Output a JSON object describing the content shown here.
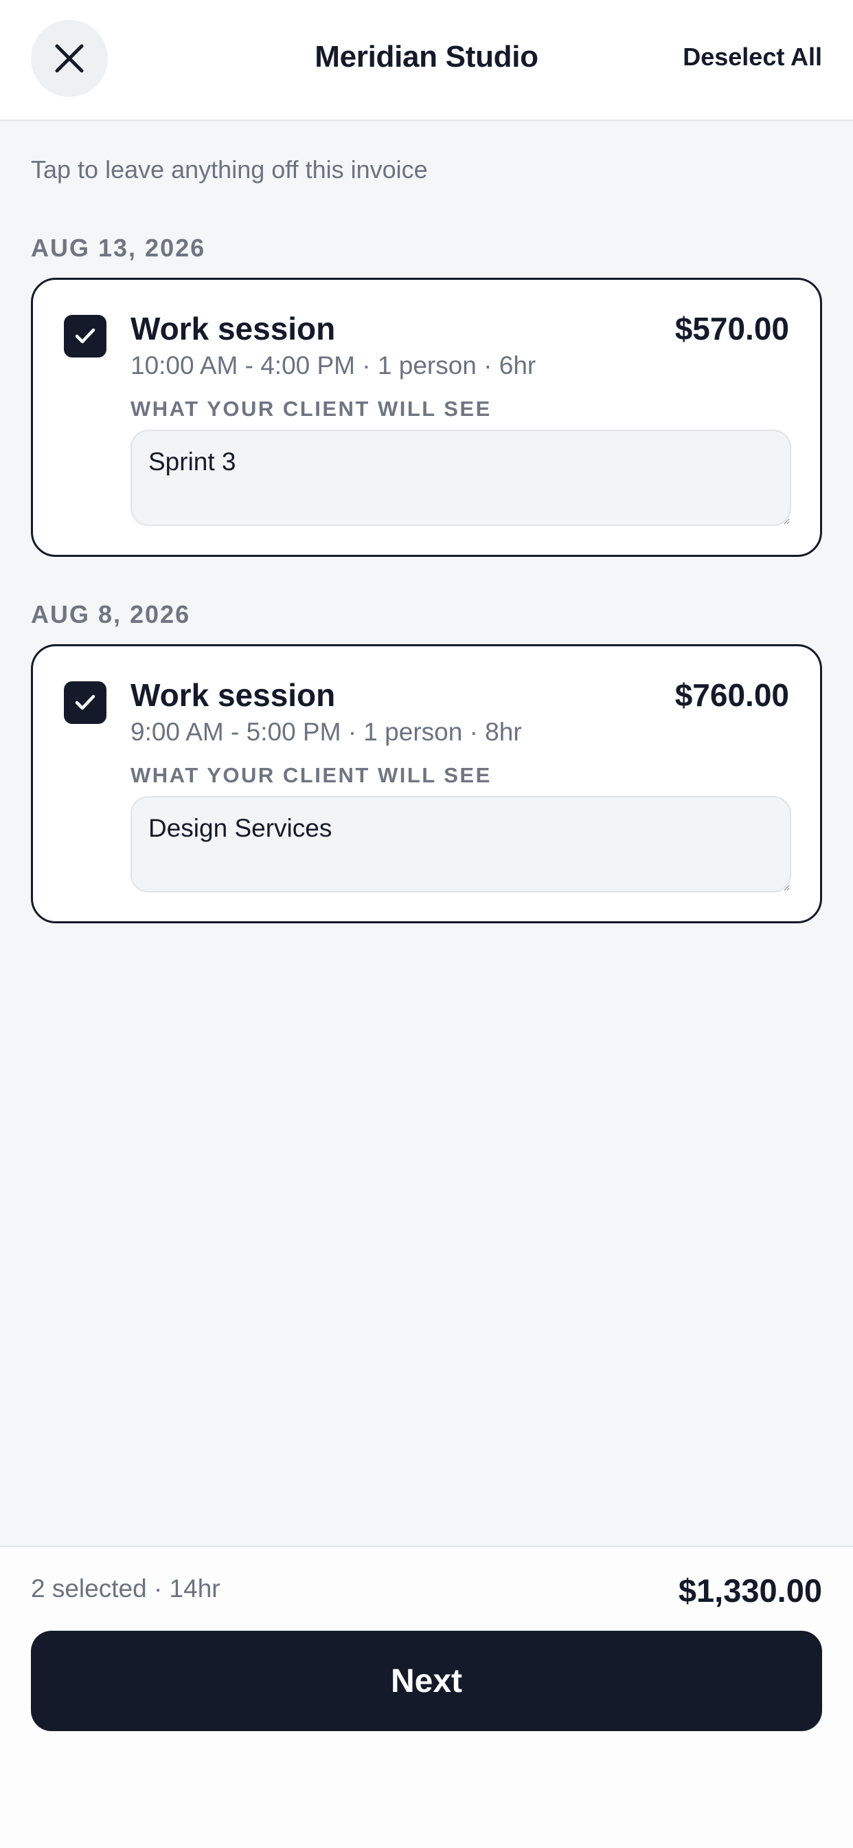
{
  "header": {
    "title": "Meridian Studio",
    "deselect_label": "Deselect All",
    "close_icon": "close-icon"
  },
  "hint": "Tap to leave anything off this invoice",
  "groups": [
    {
      "date": "AUG 13, 2026",
      "item": {
        "checked": true,
        "title": "Work session",
        "amount": "$570.00",
        "meta": "10:00 AM - 4:00 PM · 1 person · 6hr",
        "caption": "WHAT YOUR CLIENT WILL SEE",
        "client_text": "Sprint 3"
      }
    },
    {
      "date": "AUG 8, 2026",
      "item": {
        "checked": true,
        "title": "Work session",
        "amount": "$760.00",
        "meta": "9:00 AM - 5:00 PM · 1 person · 8hr",
        "caption": "WHAT YOUR CLIENT WILL SEE",
        "client_text": "Design Services"
      }
    }
  ],
  "footer": {
    "summary": "2 selected · 14hr",
    "total": "$1,330.00",
    "next_label": "Next"
  },
  "colors": {
    "primary_dark": "#141a2a",
    "background": "#f5f6f8",
    "muted_text": "#6b7280"
  }
}
